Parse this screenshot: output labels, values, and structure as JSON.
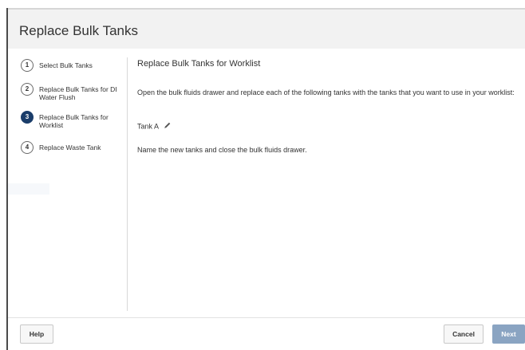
{
  "dialog": {
    "title": "Replace Bulk Tanks"
  },
  "steps": [
    {
      "number": "1",
      "label": "Select Bulk Tanks",
      "state": "pending"
    },
    {
      "number": "2",
      "label": "Replace Bulk Tanks for DI Water Flush",
      "state": "pending"
    },
    {
      "number": "3",
      "label": "Replace Bulk Tanks for Worklist",
      "state": "active"
    },
    {
      "number": "4",
      "label": "Replace Waste Tank",
      "state": "pending"
    }
  ],
  "content": {
    "title": "Replace Bulk Tanks for Worklist",
    "instruction": "Open the bulk fluids drawer and replace each of the following tanks with the tanks that you want to use in your worklist:",
    "tank_label": "Tank A",
    "closing": "Name the new tanks and close the bulk fluids drawer."
  },
  "footer": {
    "help_label": "Help",
    "cancel_label": "Cancel",
    "next_label": "Next"
  },
  "colors": {
    "active_step": "#1a3d6a",
    "next_button": "#8aa4c2",
    "header_bg": "#f2f2f2"
  },
  "icons": {
    "edit": "pencil-icon"
  }
}
